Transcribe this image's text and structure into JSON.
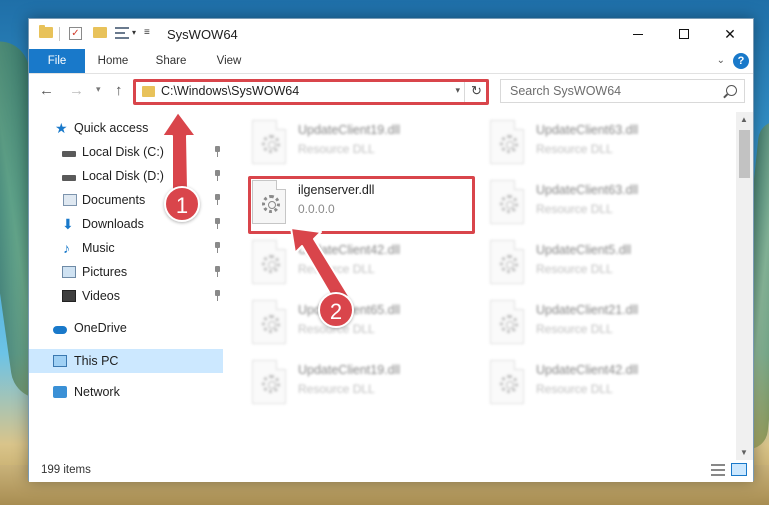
{
  "window": {
    "title": "SysWOW64"
  },
  "ribbon": {
    "tabs": [
      "File",
      "Home",
      "Share",
      "View"
    ],
    "help": "?"
  },
  "address": {
    "path": "C:\\Windows\\SysWOW64"
  },
  "search": {
    "placeholder": "Search SysWOW64"
  },
  "nav_pane": {
    "items": [
      {
        "label": "Quick access"
      },
      {
        "label": "Local Disk (C:)"
      },
      {
        "label": "Local Disk (D:)"
      },
      {
        "label": "Documents"
      },
      {
        "label": "Downloads"
      },
      {
        "label": "Music"
      },
      {
        "label": "Pictures"
      },
      {
        "label": "Videos"
      },
      {
        "label": "OneDrive"
      },
      {
        "label": "This PC"
      },
      {
        "label": "Network"
      }
    ]
  },
  "files": [
    {
      "name": "UpdateClient19.dll",
      "type": "Resource DLL"
    },
    {
      "name": "UpdateClient63.dll",
      "type": "Resource DLL"
    },
    {
      "name": "ilgenserver.dll",
      "type": "0.0.0.0"
    },
    {
      "name": "UpdateClient63.dll",
      "type": "Resource DLL"
    },
    {
      "name": "UpdateClient42.dll",
      "type": "Resource DLL"
    },
    {
      "name": "UpdateClient5.dll",
      "type": "Resource DLL"
    },
    {
      "name": "UpdateClient65.dll",
      "type": "Resource DLL"
    },
    {
      "name": "UpdateClient21.dll",
      "type": "Resource DLL"
    },
    {
      "name": "UpdateClient19.dll",
      "type": "Resource DLL"
    },
    {
      "name": "UpdateClient42.dll",
      "type": "Resource DLL"
    }
  ],
  "status": {
    "item_count": "199 items"
  },
  "annotations": {
    "step1": "1",
    "step2": "2",
    "color": "#d9454b"
  }
}
